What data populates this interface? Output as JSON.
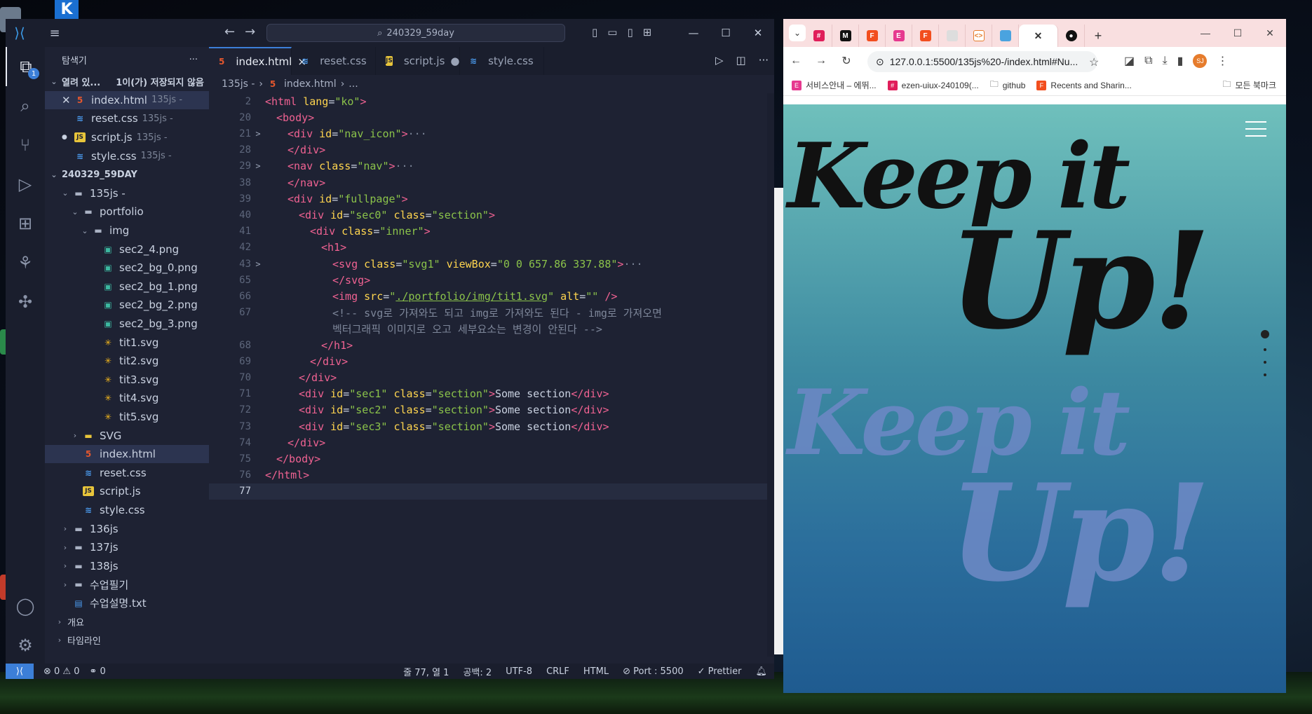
{
  "vscode": {
    "search": "240329_59day",
    "explorer_title": "탐색기",
    "open_editors": {
      "label": "열려 있...",
      "unsaved": "1이(가) 저장되지 않음"
    },
    "open_files": [
      {
        "name": "index.html",
        "folder": "135js -",
        "type": "html",
        "marker": "close"
      },
      {
        "name": "reset.css",
        "folder": "135js -",
        "type": "css",
        "marker": ""
      },
      {
        "name": "script.js",
        "folder": "135js -",
        "type": "js",
        "marker": "dot"
      },
      {
        "name": "style.css",
        "folder": "135js -",
        "type": "css",
        "marker": ""
      }
    ],
    "workspace": "240329_59DAY",
    "tree": [
      {
        "name": "135js -",
        "type": "folder",
        "depth": 1,
        "chev": "v"
      },
      {
        "name": "portfolio",
        "type": "folder",
        "depth": 2,
        "chev": "v"
      },
      {
        "name": "img",
        "type": "folder",
        "depth": 3,
        "chev": "v"
      },
      {
        "name": "sec2_4.png",
        "type": "png",
        "depth": 4
      },
      {
        "name": "sec2_bg_0.png",
        "type": "png",
        "depth": 4
      },
      {
        "name": "sec2_bg_1.png",
        "type": "png",
        "depth": 4
      },
      {
        "name": "sec2_bg_2.png",
        "type": "png",
        "depth": 4
      },
      {
        "name": "sec2_bg_3.png",
        "type": "png",
        "depth": 4
      },
      {
        "name": "tit1.svg",
        "type": "svg",
        "depth": 4
      },
      {
        "name": "tit2.svg",
        "type": "svg",
        "depth": 4
      },
      {
        "name": "tit3.svg",
        "type": "svg",
        "depth": 4
      },
      {
        "name": "tit4.svg",
        "type": "svg",
        "depth": 4
      },
      {
        "name": "tit5.svg",
        "type": "svg",
        "depth": 4
      },
      {
        "name": "SVG",
        "type": "folder-y",
        "depth": 2,
        "chev": ">"
      },
      {
        "name": "index.html",
        "type": "html",
        "depth": 2,
        "selected": true
      },
      {
        "name": "reset.css",
        "type": "css",
        "depth": 2
      },
      {
        "name": "script.js",
        "type": "js",
        "depth": 2
      },
      {
        "name": "style.css",
        "type": "css",
        "depth": 2
      },
      {
        "name": "136js",
        "type": "folder",
        "depth": 1,
        "chev": ">"
      },
      {
        "name": "137js",
        "type": "folder",
        "depth": 1,
        "chev": ">"
      },
      {
        "name": "138js",
        "type": "folder",
        "depth": 1,
        "chev": ">"
      },
      {
        "name": "수업필기",
        "type": "folder",
        "depth": 1,
        "chev": ">"
      },
      {
        "name": "수업설명.txt",
        "type": "txt",
        "depth": 1
      }
    ],
    "outline": "개요",
    "timeline": "타임라인",
    "tabs": [
      {
        "label": "index.html",
        "type": "html",
        "active": true,
        "marker": "×"
      },
      {
        "label": "reset.css",
        "type": "css",
        "active": false,
        "marker": ""
      },
      {
        "label": "script.js",
        "type": "js",
        "active": false,
        "marker": "●"
      },
      {
        "label": "style.css",
        "type": "css",
        "active": false,
        "marker": ""
      }
    ],
    "breadcrumb": [
      "135js -",
      "index.html",
      "..."
    ],
    "code": [
      {
        "n": "2",
        "fold": "",
        "indent": 0,
        "segs": [
          [
            "t",
            "<html "
          ],
          [
            "a",
            "lang"
          ],
          [
            "p",
            "="
          ],
          [
            "s",
            "\"ko\""
          ],
          [
            "t",
            ">"
          ]
        ]
      },
      {
        "n": "20",
        "fold": "",
        "indent": 1,
        "segs": [
          [
            "t",
            "<body>"
          ]
        ]
      },
      {
        "n": "21",
        "fold": ">",
        "indent": 2,
        "segs": [
          [
            "t",
            "<div "
          ],
          [
            "a",
            "id"
          ],
          [
            "p",
            "="
          ],
          [
            "s",
            "\"nav_icon\""
          ],
          [
            "t",
            ">"
          ],
          [
            "f",
            "···"
          ]
        ]
      },
      {
        "n": "28",
        "fold": "",
        "indent": 2,
        "segs": [
          [
            "t",
            "</div>"
          ]
        ]
      },
      {
        "n": "29",
        "fold": ">",
        "indent": 2,
        "segs": [
          [
            "t",
            "<nav "
          ],
          [
            "a",
            "class"
          ],
          [
            "p",
            "="
          ],
          [
            "s",
            "\"nav\""
          ],
          [
            "t",
            ">"
          ],
          [
            "f",
            "···"
          ]
        ]
      },
      {
        "n": "38",
        "fold": "",
        "indent": 2,
        "segs": [
          [
            "t",
            "</nav>"
          ]
        ]
      },
      {
        "n": "39",
        "fold": "",
        "indent": 2,
        "segs": [
          [
            "t",
            "<div "
          ],
          [
            "a",
            "id"
          ],
          [
            "p",
            "="
          ],
          [
            "s",
            "\"fullpage\""
          ],
          [
            "t",
            ">"
          ]
        ]
      },
      {
        "n": "40",
        "fold": "",
        "indent": 3,
        "segs": [
          [
            "t",
            "<div "
          ],
          [
            "a",
            "id"
          ],
          [
            "p",
            "="
          ],
          [
            "s",
            "\"sec0\""
          ],
          [
            "p",
            " "
          ],
          [
            "a",
            "class"
          ],
          [
            "p",
            "="
          ],
          [
            "s",
            "\"section\""
          ],
          [
            "t",
            ">"
          ]
        ]
      },
      {
        "n": "41",
        "fold": "",
        "indent": 4,
        "segs": [
          [
            "t",
            "<div "
          ],
          [
            "a",
            "class"
          ],
          [
            "p",
            "="
          ],
          [
            "s",
            "\"inner\""
          ],
          [
            "t",
            ">"
          ]
        ]
      },
      {
        "n": "42",
        "fold": "",
        "indent": 5,
        "segs": [
          [
            "t",
            "<h1>"
          ]
        ]
      },
      {
        "n": "43",
        "fold": ">",
        "indent": 6,
        "segs": [
          [
            "t",
            "<svg "
          ],
          [
            "a",
            "class"
          ],
          [
            "p",
            "="
          ],
          [
            "s",
            "\"svg1\""
          ],
          [
            "p",
            " "
          ],
          [
            "a",
            "viewBox"
          ],
          [
            "p",
            "="
          ],
          [
            "s",
            "\"0 0 657.86 337.88\""
          ],
          [
            "t",
            ">"
          ],
          [
            "f",
            "···"
          ]
        ]
      },
      {
        "n": "65",
        "fold": "",
        "indent": 6,
        "segs": [
          [
            "t",
            "</svg>"
          ]
        ]
      },
      {
        "n": "66",
        "fold": "",
        "indent": 6,
        "segs": [
          [
            "t",
            "<img "
          ],
          [
            "a",
            "src"
          ],
          [
            "p",
            "="
          ],
          [
            "s",
            "\""
          ],
          [
            "l",
            "./portfolio/img/tit1.svg"
          ],
          [
            "s",
            "\""
          ],
          [
            "p",
            " "
          ],
          [
            "a",
            "alt"
          ],
          [
            "p",
            "="
          ],
          [
            "s",
            "\"\""
          ],
          [
            "p",
            " "
          ],
          [
            "t",
            "/>"
          ]
        ]
      },
      {
        "n": "67",
        "fold": "",
        "indent": 6,
        "segs": [
          [
            "c",
            "<!-- svg로 가져와도 되고 img로 가져와도 된다 - img로 가져오면"
          ]
        ]
      },
      {
        "n": "",
        "fold": "",
        "indent": 6,
        "segs": [
          [
            "c",
            "벡터그래픽 이미지로 오고 세부요소는 변경이 안된다 -->"
          ]
        ]
      },
      {
        "n": "68",
        "fold": "",
        "indent": 5,
        "segs": [
          [
            "t",
            "</h1>"
          ]
        ]
      },
      {
        "n": "69",
        "fold": "",
        "indent": 4,
        "segs": [
          [
            "t",
            "</div>"
          ]
        ]
      },
      {
        "n": "70",
        "fold": "",
        "indent": 3,
        "segs": [
          [
            "t",
            "</div>"
          ]
        ]
      },
      {
        "n": "71",
        "fold": "",
        "indent": 3,
        "segs": [
          [
            "t",
            "<div "
          ],
          [
            "a",
            "id"
          ],
          [
            "p",
            "="
          ],
          [
            "s",
            "\"sec1\""
          ],
          [
            "p",
            " "
          ],
          [
            "a",
            "class"
          ],
          [
            "p",
            "="
          ],
          [
            "s",
            "\"section\""
          ],
          [
            "t",
            ">"
          ],
          [
            "p",
            "Some section"
          ],
          [
            "t",
            "</div>"
          ]
        ]
      },
      {
        "n": "72",
        "fold": "",
        "indent": 3,
        "segs": [
          [
            "t",
            "<div "
          ],
          [
            "a",
            "id"
          ],
          [
            "p",
            "="
          ],
          [
            "s",
            "\"sec2\""
          ],
          [
            "p",
            " "
          ],
          [
            "a",
            "class"
          ],
          [
            "p",
            "="
          ],
          [
            "s",
            "\"section\""
          ],
          [
            "t",
            ">"
          ],
          [
            "p",
            "Some section"
          ],
          [
            "t",
            "</div>"
          ]
        ]
      },
      {
        "n": "73",
        "fold": "",
        "indent": 3,
        "segs": [
          [
            "t",
            "<div "
          ],
          [
            "a",
            "id"
          ],
          [
            "p",
            "="
          ],
          [
            "s",
            "\"sec3\""
          ],
          [
            "p",
            " "
          ],
          [
            "a",
            "class"
          ],
          [
            "p",
            "="
          ],
          [
            "s",
            "\"section\""
          ],
          [
            "t",
            ">"
          ],
          [
            "p",
            "Some section"
          ],
          [
            "t",
            "</div>"
          ]
        ]
      },
      {
        "n": "74",
        "fold": "",
        "indent": 2,
        "segs": [
          [
            "t",
            "</div>"
          ]
        ]
      },
      {
        "n": "75",
        "fold": "",
        "indent": 1,
        "segs": [
          [
            "t",
            "</body>"
          ]
        ]
      },
      {
        "n": "76",
        "fold": "",
        "indent": 0,
        "segs": [
          [
            "t",
            "</html>"
          ]
        ]
      },
      {
        "n": "77",
        "fold": "",
        "indent": 0,
        "segs": [],
        "current": true
      }
    ],
    "status": {
      "errors": "⊗ 0 ⚠ 0",
      "ports": "⚭ 0",
      "position": "줄 77, 열 1",
      "spaces": "공백: 2",
      "encoding": "UTF-8",
      "eol": "CRLF",
      "language": "HTML",
      "port": "Port : 5500",
      "prettier": "Prettier"
    },
    "colors": {
      "accent": "#3c7fd8",
      "tag": "#f06292",
      "attr": "#ffd54f",
      "string": "#8bc34a"
    }
  },
  "chrome": {
    "url": "127.0.0.1:5500/135js%20-/index.html#Nu...",
    "bookmarks": [
      "서비스안내 – 에뛰...",
      "ezen-uiux-240109(...",
      "github",
      "Recents and Sharin..."
    ],
    "all_bookmarks": "모든 북마크",
    "profile": "SJ",
    "page": {
      "title_line1": "Keep it",
      "title_line2": "Up!",
      "ghost_line1": "Keep it",
      "ghost_line2": "Up!"
    }
  }
}
